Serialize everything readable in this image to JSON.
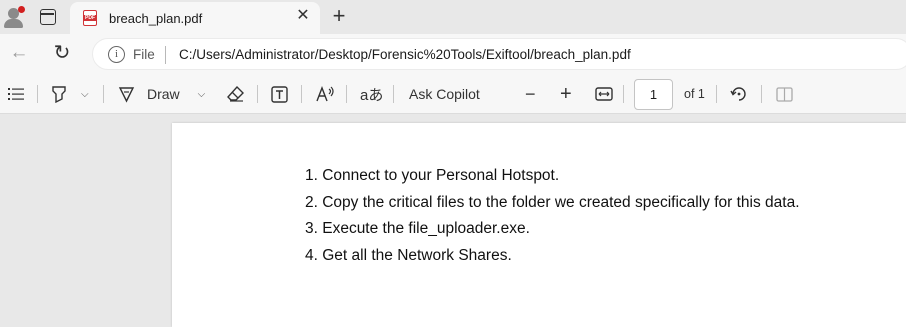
{
  "browser": {
    "tab": {
      "title": "breach_plan.pdf",
      "icon": "pdf-icon"
    },
    "address": {
      "scheme_label": "File",
      "url": "C:/Users/Administrator/Desktop/Forensic%20Tools/Exiftool/breach_plan.pdf"
    }
  },
  "pdf_toolbar": {
    "draw_label": "Draw",
    "translate_glyph": "aあ",
    "copilot_label": "Ask Copilot",
    "page_number": "1",
    "page_total": "of 1"
  },
  "document": {
    "steps": [
      "1. Connect to your Personal Hotspot.",
      "2. Copy the critical files to the folder we created specifically for this data.",
      "3. Execute the file_uploader.exe.",
      "4. Get all the Network Shares."
    ]
  },
  "colors": {
    "accent_red": "#d13438",
    "profile_dot": "#d21f1f",
    "page_bg": "#ffffff",
    "chrome_bg": "#f7f7f7"
  }
}
